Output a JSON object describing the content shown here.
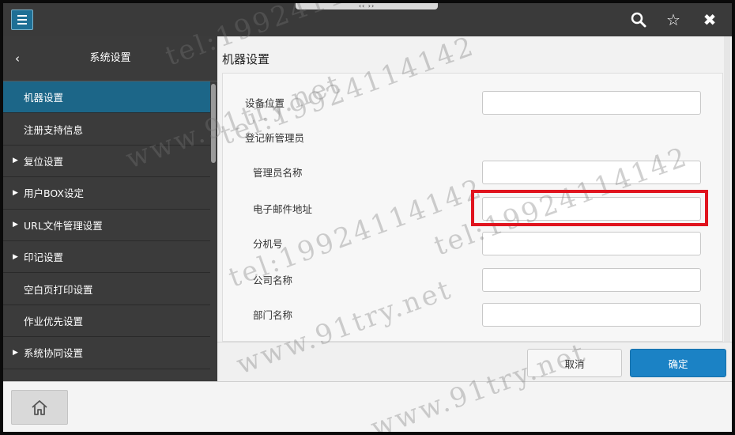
{
  "topbar": {
    "notch_text": "‹‹ ››",
    "icons": [
      "menu-icon",
      "search-icon",
      "star-icon",
      "close-icon"
    ],
    "search_glyph": "🔍",
    "star_glyph": "☆",
    "close_glyph": "✖"
  },
  "sidebar": {
    "back_glyph": "‹",
    "title": "系统设置",
    "items": [
      {
        "label": "机器设置",
        "expandable": false,
        "active": true
      },
      {
        "label": "注册支持信息",
        "expandable": false,
        "active": false
      },
      {
        "label": "复位设置",
        "expandable": true,
        "active": false
      },
      {
        "label": "用户BOX设定",
        "expandable": true,
        "active": false
      },
      {
        "label": "URL文件管理设置",
        "expandable": true,
        "active": false
      },
      {
        "label": "印记设置",
        "expandable": true,
        "active": false
      },
      {
        "label": "空白页打印设置",
        "expandable": false,
        "active": false
      },
      {
        "label": "作业优先设置",
        "expandable": false,
        "active": false
      },
      {
        "label": "系统协同设置",
        "expandable": true,
        "active": false
      }
    ],
    "caret_glyph": "▶"
  },
  "main": {
    "title": "机器设置",
    "fields": [
      {
        "label": "设备位置",
        "value": "",
        "has_input": true
      },
      {
        "label": "登记新管理员",
        "value": "",
        "has_input": false
      },
      {
        "label": "管理员名称",
        "value": "",
        "has_input": true
      },
      {
        "label": "电子邮件地址",
        "value": "",
        "has_input": true
      },
      {
        "label": "分机号",
        "value": "",
        "has_input": true
      },
      {
        "label": "公司名称",
        "value": "",
        "has_input": true
      },
      {
        "label": "部门名称",
        "value": "",
        "has_input": true
      }
    ],
    "cancel_label": "取消",
    "ok_label": "确定"
  },
  "watermark": {
    "text_a": "tel:19924114142",
    "text_b": "www.91try.net"
  },
  "colors": {
    "accent": "#1c6688",
    "ok_button": "#1b82c5",
    "highlight": "#e0141e"
  }
}
